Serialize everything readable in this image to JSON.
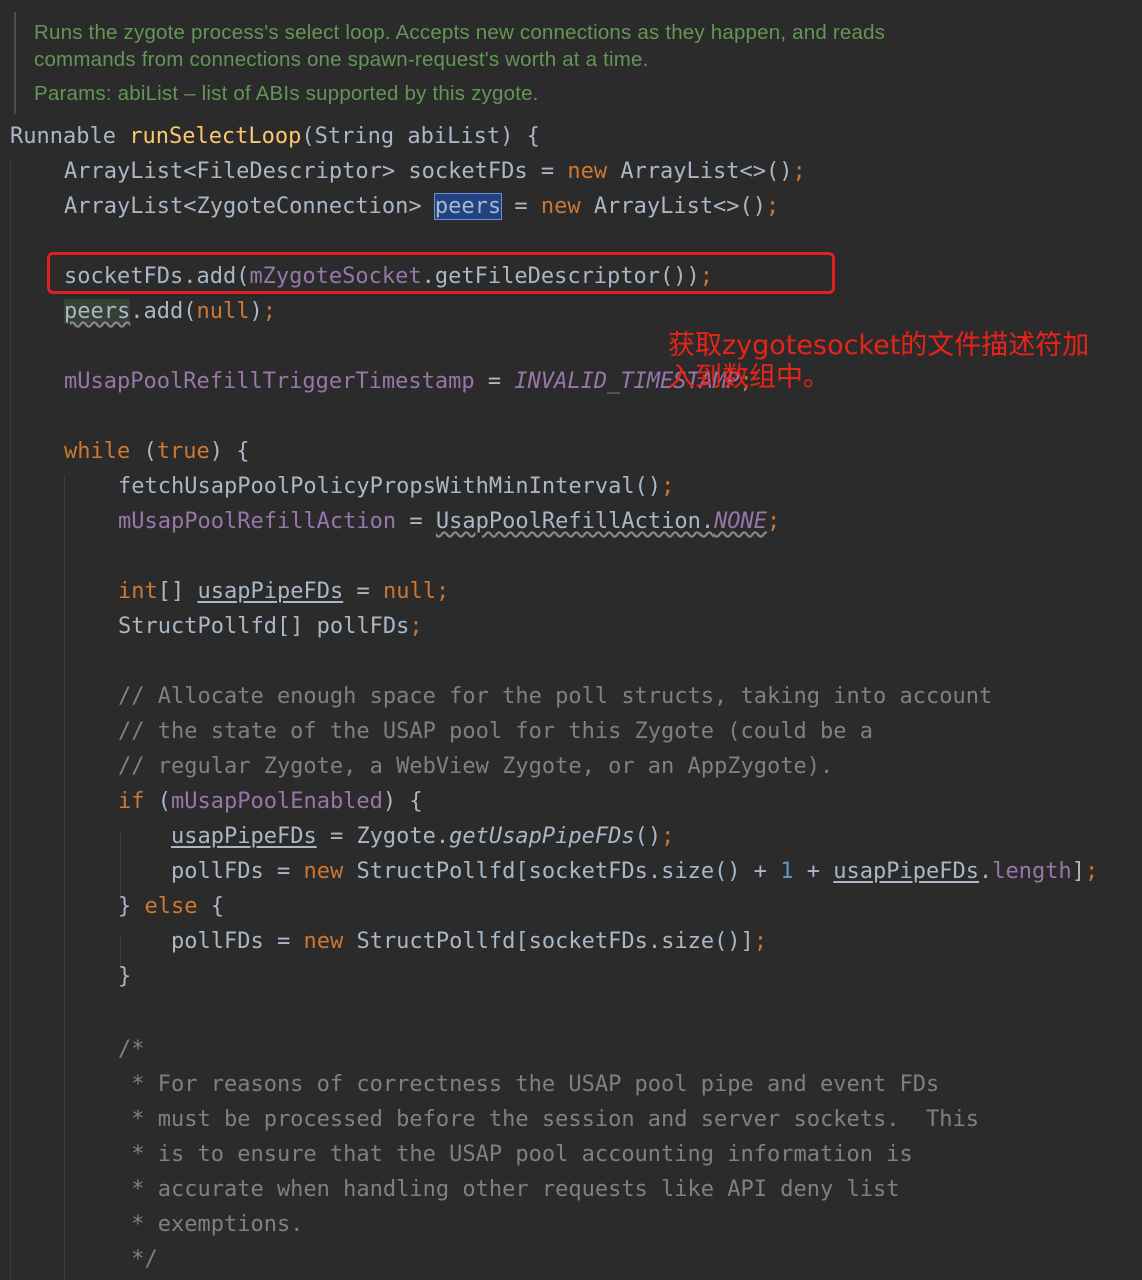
{
  "doc_comment": {
    "line1": "Runs the zygote process's select loop. Accepts new connections as they happen, and reads",
    "line2": "commands from connections one spawn-request's worth at a time.",
    "params": "Params: abiList – list of ABIs supported by this zygote."
  },
  "code": {
    "sig_type": "Runnable ",
    "sig_method": "runSelectLoop",
    "sig_params": "(String abiList) {",
    "l1_a": "ArrayList<FileDescriptor> socketFDs = ",
    "l1_new": "new",
    "l1_b": " ArrayList<>()",
    "l1_semi": ";",
    "l2_a": "ArrayList<ZygoteConnection> ",
    "l2_peers": "peers",
    "l2_b": " = ",
    "l2_new": "new",
    "l2_c": " ArrayList<>()",
    "l2_semi": ";",
    "l3_a": "socketFDs.add(",
    "l3_field": "mZygoteSocket",
    "l3_b": ".getFileDescriptor())",
    "l3_semi": ";",
    "l4_peers": "peers",
    "l4_a": ".add(",
    "l4_null": "null",
    "l4_b": ")",
    "l4_semi": ";",
    "l5_field": "mUsapPoolRefillTriggerTimestamp",
    "l5_a": " = ",
    "l5_const": "INVALID_TIMESTAMP",
    "l5_semi": ";",
    "l6_while": "while",
    "l6_a": " (",
    "l6_true": "true",
    "l6_b": ") {",
    "l7_a": "fetchUsapPoolPolicyPropsWithMinInterval()",
    "l7_semi": ";",
    "l8_field": "mUsapPoolRefillAction",
    "l8_a": " = ",
    "l8_cls": "UsapPoolRefillAction",
    "l8_dot": ".",
    "l8_const": "NONE",
    "l8_semi": ";",
    "l9_int": "int",
    "l9_a": "[] ",
    "l9_var": "usapPipeFDs",
    "l9_b": " = ",
    "l9_null": "null",
    "l9_semi": ";",
    "l10_a": "StructPollfd[] pollFDs",
    "l10_semi": ";",
    "c1": "// Allocate enough space for the poll structs, taking into account",
    "c2": "// the state of the USAP pool for this Zygote (could be a",
    "c3": "// regular Zygote, a WebView Zygote, or an AppZygote).",
    "l11_if": "if",
    "l11_a": " (",
    "l11_field": "mUsapPoolEnabled",
    "l11_b": ") {",
    "l12_var": "usapPipeFDs",
    "l12_a": " = Zygote.",
    "l12_m": "getUsapPipeFDs",
    "l12_b": "()",
    "l12_semi": ";",
    "l13_a": "pollFDs = ",
    "l13_new": "new",
    "l13_b": " StructPollfd[socketFDs.size() + ",
    "l13_one": "1",
    "l13_c": " + ",
    "l13_var": "usapPipeFDs",
    "l13_dot": ".",
    "l13_len": "length",
    "l13_d": "]",
    "l13_semi": ";",
    "l14_a": "} ",
    "l14_else": "else",
    "l14_b": " {",
    "l15_a": "pollFDs = ",
    "l15_new": "new",
    "l15_b": " StructPollfd[socketFDs.size()]",
    "l15_semi": ";",
    "l16": "}",
    "b1": "/*",
    "b2": " * For reasons of correctness the USAP pool pipe and event FDs",
    "b3": " * must be processed before the session and server sockets.  This",
    "b4": " * is to ensure that the USAP pool accounting information is",
    "b5": " * accurate when handling other requests like API deny list",
    "b6": " * exemptions.",
    "b7": " */"
  },
  "annotation": {
    "text": "获取zygotesocket的文件描述符加入到数组中。",
    "color": "#e8231a"
  },
  "colors": {
    "background": "#2b2b2b",
    "keyword": "#cc7832",
    "method": "#ffc66d",
    "field": "#9876aa",
    "comment": "#808080",
    "doc": "#629755",
    "default": "#a9b7c6",
    "number": "#6897bb"
  }
}
